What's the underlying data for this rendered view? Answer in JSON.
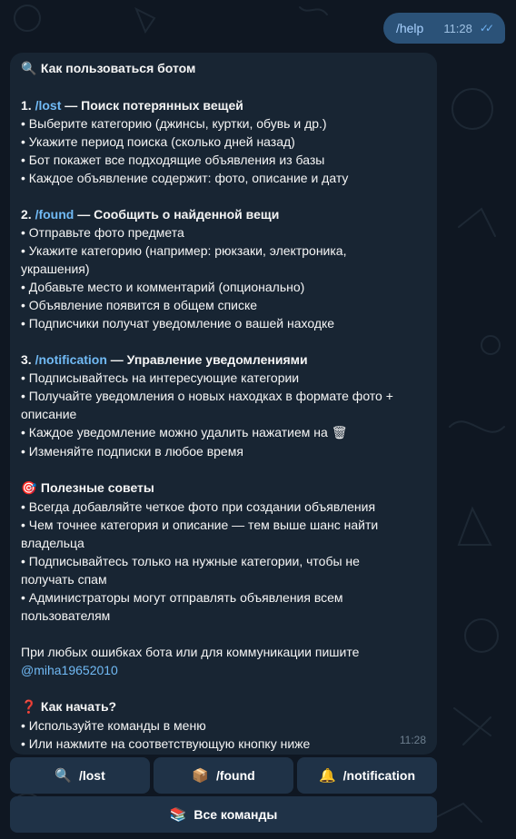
{
  "outgoing": {
    "text": "/help",
    "time": "11:28",
    "status_icon": "double-check-icon"
  },
  "incoming": {
    "time": "11:28",
    "header": {
      "icon": "magnifier-icon",
      "text": "Как пользоваться ботом"
    },
    "section1": {
      "num": "1.",
      "cmd": "/lost",
      "title": " — Поиск потерянных вещей",
      "items": [
        "• Выберите категорию (джинсы, куртки, обувь и др.)",
        "• Укажите период поиска (сколько дней назад)",
        "• Бот покажет все подходящие объявления из базы",
        "• Каждое объявление содержит: фото, описание и дату"
      ]
    },
    "section2": {
      "num": "2.",
      "cmd": "/found",
      "title": " — Сообщить о найденной вещи",
      "items": [
        "• Отправьте фото предмета",
        "• Укажите категорию (например: рюкзаки, электроника,",
        "украшения)",
        "• Добавьте место и комментарий (опционально)",
        "• Объявление появится в общем списке",
        "• Подписчики получат уведомление о вашей находке"
      ]
    },
    "section3": {
      "num": "3.",
      "cmd": "/notification",
      "title": " — Управление уведомлениями",
      "items": [
        "• Подписывайтесь на интересующие категории",
        "• Получайте уведомления о новых находках в формате фото +",
        "описание",
        "• Каждое уведомление можно удалить нажатием на",
        "• Изменяйте подписки в любое время"
      ],
      "trash_icon": "trash-icon"
    },
    "tips": {
      "icon": "target-icon",
      "title": "Полезные советы",
      "items": [
        "• Всегда добавляйте четкое фото при создании объявления",
        "• Чем точнее категория и описание — тем выше шанс найти",
        "владельца",
        "• Подписывайтесь только на нужные категории, чтобы не",
        "получать спам",
        "• Администраторы могут отправлять объявления всем",
        "пользователям"
      ]
    },
    "contact": {
      "text": "При любых ошибках бота или для коммуникации пишите",
      "handle": "@miha19652010"
    },
    "start": {
      "icon": "question-icon",
      "title": "Как начать?",
      "items": [
        "• Используйте команды в меню",
        "• Или нажмите на соответствующую кнопку ниже"
      ]
    }
  },
  "keyboard": {
    "row1": [
      {
        "icon": "magnifier-icon",
        "label": "/lost"
      },
      {
        "icon": "package-icon",
        "label": "/found"
      },
      {
        "icon": "bell-icon",
        "label": "/notification"
      }
    ],
    "row2": [
      {
        "icon": "books-icon",
        "label": "Все команды"
      }
    ]
  }
}
